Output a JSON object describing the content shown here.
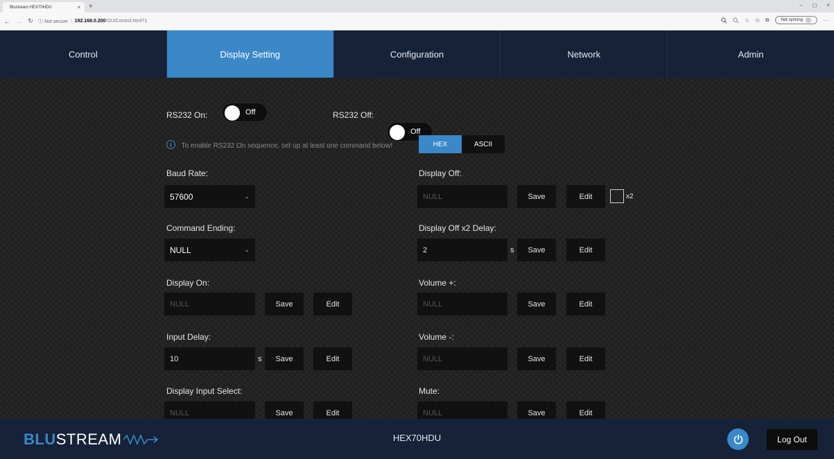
{
  "browser": {
    "tab_title": "Blustream HEX70HDU",
    "tab_close": "×",
    "new_tab": "+",
    "win_min": "–",
    "win_max": "◻",
    "win_close": "×",
    "back": "←",
    "forward": "→",
    "reload": "↻",
    "not_secure": "ⓘ Not secure",
    "url_host": "192.168.0.200",
    "url_path": "/GUIControl.html?1",
    "sync_label": "Not syncing",
    "more": "···"
  },
  "nav": {
    "tabs": [
      {
        "label": "Control"
      },
      {
        "label": "Display Setting"
      },
      {
        "label": "Configuration"
      },
      {
        "label": "Network"
      },
      {
        "label": "Admin"
      }
    ]
  },
  "rs232": {
    "on_label": "RS232 On:",
    "on_state": "Off",
    "off_label": "RS232 Off:",
    "off_state": "Off",
    "info_text": "To enable RS232 On sequence, set up at least one command below!",
    "format_options": [
      "HEX",
      "ASCII"
    ]
  },
  "left": {
    "baud_label": "Baud Rate:",
    "baud_value": "57600",
    "ending_label": "Command Ending:",
    "ending_value": "NULL",
    "display_on_label": "Display On:",
    "display_on_placeholder": "NULL",
    "input_delay_label": "Input Delay:",
    "input_delay_value": "10",
    "input_select_label": "Display Input Select:",
    "input_select_placeholder": "NULL"
  },
  "right": {
    "display_off_label": "Display Off:",
    "display_off_placeholder": "NULL",
    "x2_label": "x2",
    "x2_delay_label": "Display Off x2 Delay:",
    "x2_delay_value": "2",
    "vol_up_label": "Volume +:",
    "vol_up_placeholder": "NULL",
    "vol_down_label": "Volume -:",
    "vol_down_placeholder": "NULL",
    "mute_label": "Mute:",
    "mute_placeholder": "NULL"
  },
  "common": {
    "save": "Save",
    "edit": "Edit",
    "seconds_unit": "s",
    "select_chevron": "⌄"
  },
  "footer": {
    "logo_blu": "BLU",
    "logo_stream": "STREAM",
    "model": "HEX70HDU",
    "logout": "Log Out"
  },
  "colors": {
    "accent": "#3a88c8",
    "nav_bg": "#152238"
  }
}
